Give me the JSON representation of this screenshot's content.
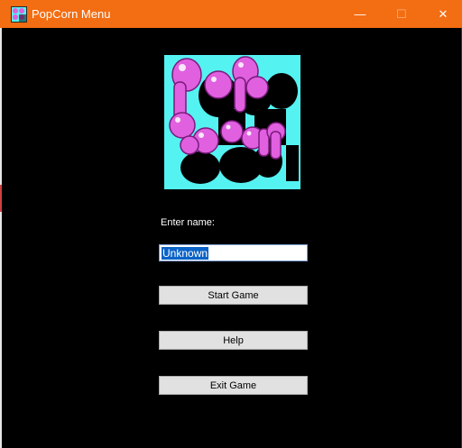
{
  "window": {
    "title": "PopCorn Menu",
    "controls": {
      "minimize": "—",
      "maximize": "☐",
      "close": "✕"
    }
  },
  "logo": {
    "icon": "popcorn-logo",
    "colors": {
      "background": "#55f2f2",
      "letters": "#e060e0",
      "shadow": "#000000"
    }
  },
  "form": {
    "name_label": "Enter name:",
    "name_value": "Unknown"
  },
  "buttons": {
    "start": "Start Game",
    "help": "Help",
    "exit": "Exit Game"
  },
  "colors": {
    "titlebar": "#f36d12",
    "background": "#000000",
    "selection": "#0a63c8"
  }
}
